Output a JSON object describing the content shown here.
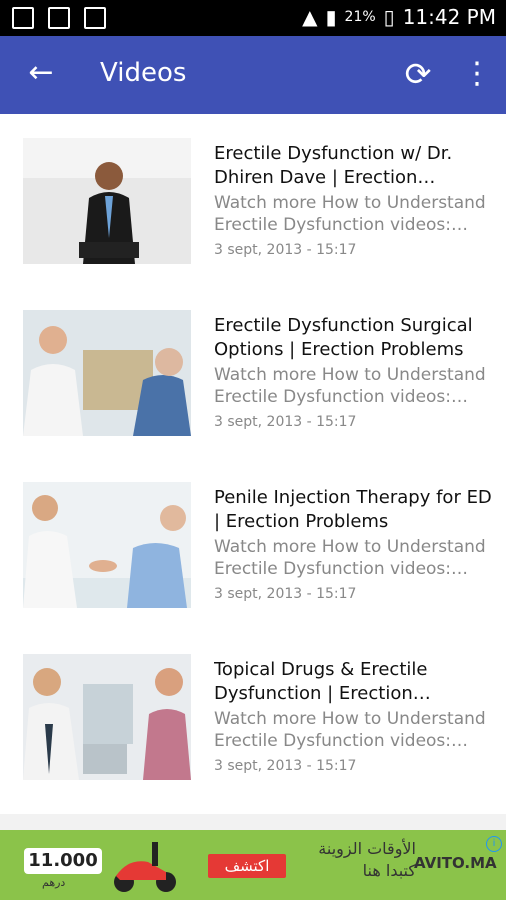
{
  "status_bar": {
    "battery": "21%",
    "time": "11:42 PM"
  },
  "app_bar": {
    "title": "Videos"
  },
  "items": [
    {
      "title": "Erectile Dysfunction w/ Dr. Dhiren Dave | Erection…",
      "description": "Watch more How to Understand Erectile Dysfunction videos:…",
      "date": "3 sept, 2013 - 15:17"
    },
    {
      "title": "Erectile Dysfunction Surgical Options | Erection Problems",
      "description": "Watch more How to Understand Erectile Dysfunction videos:…",
      "date": "3 sept, 2013 - 15:17"
    },
    {
      "title": "Penile Injection Therapy for ED | Erection Problems",
      "description": "Watch more How to Understand Erectile Dysfunction videos:…",
      "date": "3 sept, 2013 - 15:17"
    },
    {
      "title": "Topical Drugs & Erectile Dysfunction | Erection…",
      "description": "Watch more How to Understand Erectile Dysfunction videos:…",
      "date": "3 sept, 2013 - 15:17"
    }
  ],
  "ad": {
    "price": "11.000",
    "currency": "درهم",
    "cta": "اكتشف",
    "headline": "الأوقات الزوينة كتبدا هنا",
    "brand": "AVITO.MA"
  },
  "colors": {
    "app_bar": "#3f51b5",
    "banner": "#8bc34a",
    "cta": "#e53935"
  }
}
